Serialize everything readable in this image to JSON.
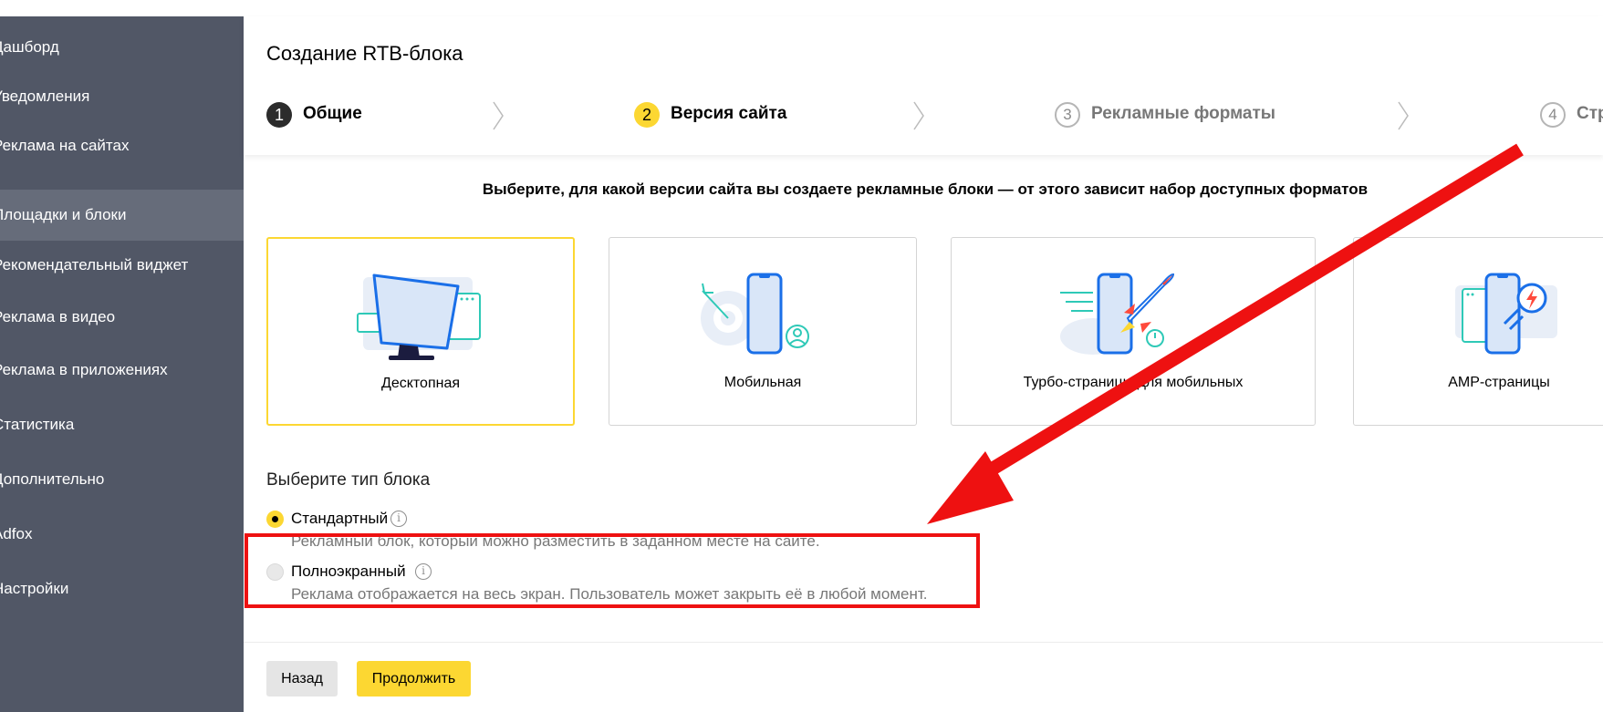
{
  "sidebar": {
    "items": [
      {
        "label": "Дашборд"
      },
      {
        "label": "Уведомления"
      },
      {
        "label": "Реклама на сайтах"
      },
      {
        "label": "Площадки и блоки",
        "active": true
      },
      {
        "label": "Рекомендательный виджет"
      },
      {
        "label": "Реклама в видео"
      },
      {
        "label": "Реклама в приложениях"
      },
      {
        "label": "Статистика"
      },
      {
        "label": "Дополнительно"
      },
      {
        "label": "Adfox"
      },
      {
        "label": "Настройки"
      }
    ]
  },
  "header": {
    "title": "Создание RTB-блока",
    "steps": [
      {
        "num": "1",
        "label": "Общие",
        "state": "done"
      },
      {
        "num": "2",
        "label": "Версия сайта",
        "state": "current"
      },
      {
        "num": "3",
        "label": "Рекламные форматы",
        "state": "future"
      },
      {
        "num": "4",
        "label": "Стр",
        "state": "future"
      }
    ]
  },
  "main": {
    "instruction": "Выберите, для какой версии сайта вы создаете рекламные блоки — от этого зависит набор доступных форматов",
    "cards": [
      {
        "label": "Десктопная",
        "selected": true,
        "icon": "desktop-monitor-icon"
      },
      {
        "label": "Мобильная",
        "selected": false,
        "icon": "mobile-phone-icon"
      },
      {
        "label": "Турбо-страницы для мобильных",
        "selected": false,
        "icon": "turbo-rocket-icon"
      },
      {
        "label": "AMP-страницы",
        "selected": false,
        "icon": "amp-lightning-icon"
      }
    ],
    "block_type_title": "Выберите тип блока",
    "block_types": [
      {
        "label": "Стандартный",
        "desc": "Рекламный блок, который можно разместить в заданном месте на сайте.",
        "checked": true
      },
      {
        "label": "Полноэкранный",
        "desc": "Реклама отображается на весь экран. Пользователь может закрыть её в любой момент.",
        "checked": false
      }
    ]
  },
  "footer": {
    "back_label": "Назад",
    "next_label": "Продолжить"
  },
  "colors": {
    "sidebar_bg": "#515766",
    "sidebar_active": "#666c7a",
    "accent_yellow": "#fcd732",
    "annotation_red": "#ee1111"
  }
}
